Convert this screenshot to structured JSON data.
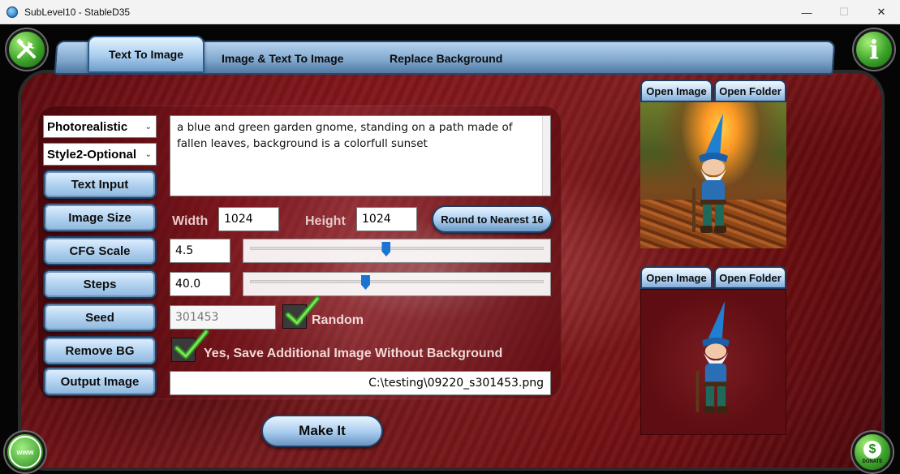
{
  "window": {
    "title": "SubLevel10 - StableD35",
    "minimize": "—",
    "maximize": "☐",
    "close": "✕"
  },
  "tabs": [
    {
      "label": "Text To Image",
      "active": true
    },
    {
      "label": "Image & Text To Image",
      "active": false
    },
    {
      "label": "Replace Background",
      "active": false
    }
  ],
  "corner_buttons": {
    "info": "i",
    "www": "www",
    "donate": "DONATE",
    "dollar": "$"
  },
  "selects": {
    "style1": "Photorealistic",
    "style2": "Style2-Optional"
  },
  "sidebar": {
    "items": [
      {
        "label": "Text Input"
      },
      {
        "label": "Image Size"
      },
      {
        "label": "CFG Scale"
      },
      {
        "label": "Steps"
      },
      {
        "label": "Seed"
      },
      {
        "label": "Remove BG"
      },
      {
        "label": "Output Image"
      }
    ]
  },
  "prompt": "a blue and green garden gnome, standing on a path made of fallen leaves, background is a colorfull sunset",
  "size": {
    "width_label": "Width",
    "width_value": "1024",
    "height_label": "Height",
    "height_value": "1024",
    "round_button": "Round to Nearest 16"
  },
  "cfg": {
    "value": "4.5",
    "slider_fraction": 0.46
  },
  "steps": {
    "value": "40.0",
    "slider_fraction": 0.39
  },
  "seed": {
    "value": "301453",
    "random_label": "Random",
    "random_checked": true
  },
  "remove_bg": {
    "label": "Yes, Save Additional Image Without Background",
    "checked": true
  },
  "output_path": "C:\\testing\\09220_s301453.png",
  "make_button": "Make It",
  "preview_panes": [
    {
      "open_image": "Open Image",
      "open_folder": "Open Folder"
    },
    {
      "open_image": "Open Image",
      "open_folder": "Open Folder"
    }
  ],
  "colors": {
    "accent_blue": "#a9cdef",
    "background_red": "#8c1a20",
    "corner_green": "#3ca32a",
    "slider_thumb": "#1b74d1"
  }
}
